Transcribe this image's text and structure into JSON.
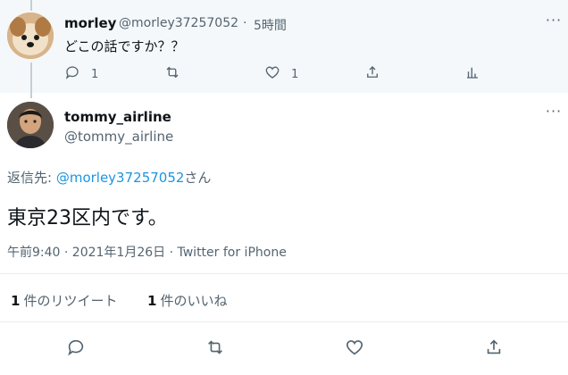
{
  "parent_tweet": {
    "name": "morley",
    "handle": "@morley37257052",
    "dot": "·",
    "time": "5時間",
    "text": "どこの話ですか？？",
    "reply_count": "1",
    "like_count": "1",
    "more": "···"
  },
  "main_tweet": {
    "name": "tommy_airline",
    "handle": "@tommy_airline",
    "reply_prefix": "返信先: ",
    "reply_mention": "@morley37257052",
    "reply_suffix": "さん",
    "text": "東京23区内です。",
    "meta": "午前9:40 · 2021年1月26日 · Twitter for iPhone",
    "more": "···",
    "retweets_num": "1",
    "retweets_label": "件のリツイート",
    "likes_num": "1",
    "likes_label": "件のいいね"
  }
}
